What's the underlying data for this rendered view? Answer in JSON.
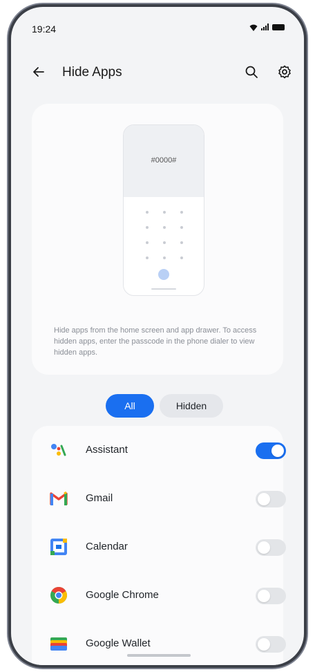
{
  "status_bar": {
    "time": "19:24"
  },
  "app_bar": {
    "title": "Hide Apps",
    "back_icon": "arrow-left-icon",
    "search_icon": "search-icon",
    "settings_icon": "gear-icon"
  },
  "intro_card": {
    "passcode_text": "#0000#",
    "description": "Hide apps from the home screen and app drawer. To access hidden apps, enter the passcode in the phone dialer to view hidden apps."
  },
  "filter": {
    "all_label": "All",
    "hidden_label": "Hidden",
    "selected": "All"
  },
  "apps": [
    {
      "name": "Assistant",
      "hidden": true
    },
    {
      "name": "Gmail",
      "hidden": false
    },
    {
      "name": "Calendar",
      "hidden": false
    },
    {
      "name": "Google Chrome",
      "hidden": false
    },
    {
      "name": "Google Wallet",
      "hidden": false
    }
  ],
  "colors": {
    "accent": "#1a6ff0",
    "toggle_off": "#e3e5e8",
    "background": "#f3f4f6",
    "card": "#fbfbfc"
  }
}
